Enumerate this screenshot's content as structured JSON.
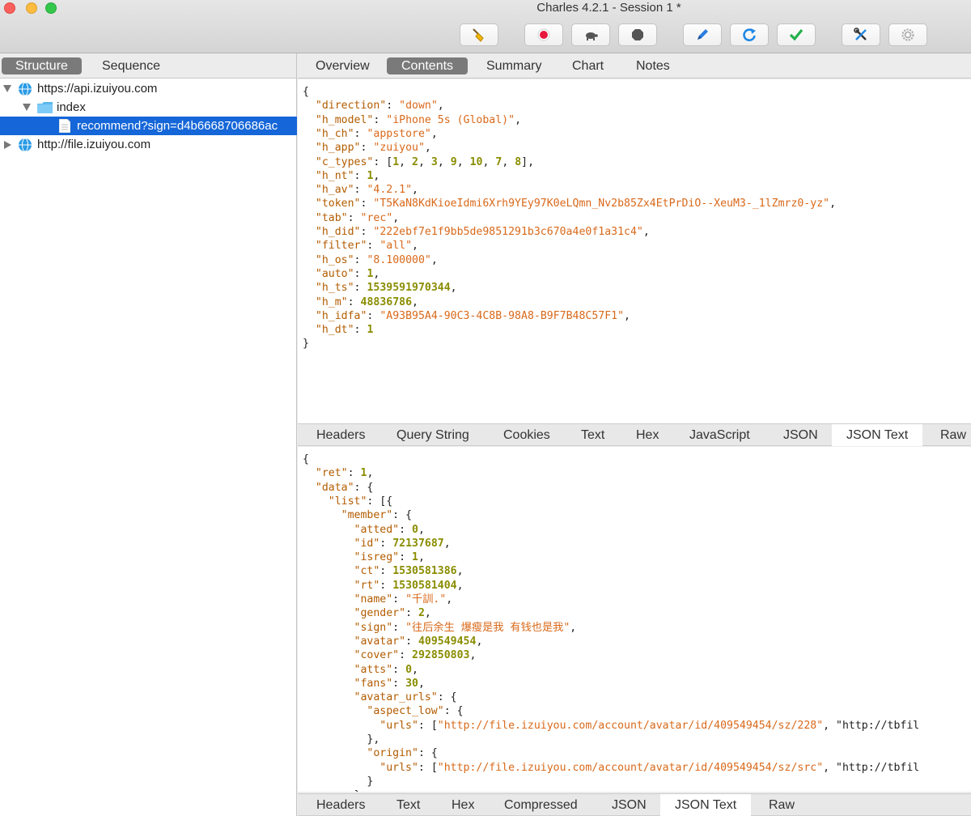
{
  "window": {
    "title": "Charles 4.2.1 - Session 1 *"
  },
  "toolbar": {
    "buttons": [
      {
        "icon": "broom-icon"
      },
      {
        "icon": "record-icon"
      },
      {
        "icon": "turtle-icon"
      },
      {
        "icon": "stop-icon"
      },
      {
        "icon": "pen-icon"
      },
      {
        "icon": "refresh-icon"
      },
      {
        "icon": "check-icon"
      },
      {
        "icon": "tools-icon"
      },
      {
        "icon": "settings-icon"
      }
    ]
  },
  "left": {
    "tabs": [
      {
        "label": "Structure",
        "active": true
      },
      {
        "label": "Sequence",
        "active": false
      }
    ],
    "tree": [
      {
        "label": "https://api.izuiyou.com",
        "icon": "globe-icon",
        "expanded": true,
        "level": 0
      },
      {
        "label": "index",
        "icon": "folder-icon",
        "expanded": true,
        "level": 1
      },
      {
        "label": "recommend?sign=d4b6668706686ac",
        "icon": "document-icon",
        "level": 2,
        "selected": true
      },
      {
        "label": "http://file.izuiyou.com",
        "icon": "globe-icon",
        "expanded": false,
        "level": 0
      }
    ]
  },
  "right": {
    "tabs": [
      {
        "label": "Overview",
        "active": false
      },
      {
        "label": "Contents",
        "active": true
      },
      {
        "label": "Summary",
        "active": false
      },
      {
        "label": "Chart",
        "active": false
      },
      {
        "label": "Notes",
        "active": false
      }
    ],
    "request_lines": [
      "{",
      "  \"direction\": \"down\",",
      "  \"h_model\": \"iPhone 5s (Global)\",",
      "  \"h_ch\": \"appstore\",",
      "  \"h_app\": \"zuiyou\",",
      "  \"c_types\": [1, 2, 3, 9, 10, 7, 8],",
      "  \"h_nt\": 1,",
      "  \"h_av\": \"4.2.1\",",
      "  \"token\": \"T5KaN8KdKioeIdmi6Xrh9YEy97K0eLQmn_Nv2b85Zx4EtPrDiO--XeuM3-_1lZmrz0-yz\",",
      "  \"tab\": \"rec\",",
      "  \"h_did\": \"222ebf7e1f9bb5de9851291b3c670a4e0f1a31c4\",",
      "  \"filter\": \"all\",",
      "  \"h_os\": \"8.100000\",",
      "  \"auto\": 1,",
      "  \"h_ts\": 1539591970344,",
      "  \"h_m\": 48836786,",
      "  \"h_idfa\": \"A93B95A4-90C3-4C8B-98A8-B9F7B48C57F1\",",
      "  \"h_dt\": 1",
      "}"
    ],
    "request_tabs": [
      {
        "label": "Headers",
        "active": false
      },
      {
        "label": "Query String",
        "active": false
      },
      {
        "label": "Cookies",
        "active": false
      },
      {
        "label": "Text",
        "active": false
      },
      {
        "label": "Hex",
        "active": false
      },
      {
        "label": "JavaScript",
        "active": false
      },
      {
        "label": "JSON",
        "active": false
      },
      {
        "label": "JSON Text",
        "active": true
      },
      {
        "label": "Raw",
        "active": false
      }
    ],
    "response_lines": [
      "{",
      "  \"ret\": 1,",
      "  \"data\": {",
      "    \"list\": [{",
      "      \"member\": {",
      "        \"atted\": 0,",
      "        \"id\": 72137687,",
      "        \"isreg\": 1,",
      "        \"ct\": 1530581386,",
      "        \"rt\": 1530581404,",
      "        \"name\": \"千訓.\",",
      "        \"gender\": 2,",
      "        \"sign\": \"往后余生 爆瘦是我 有钱也是我\",",
      "        \"avatar\": 409549454,",
      "        \"cover\": 292850803,",
      "        \"atts\": 0,",
      "        \"fans\": 30,",
      "        \"avatar_urls\": {",
      "          \"aspect_low\": {",
      "            \"urls\": [\"http://file.izuiyou.com/account/avatar/id/409549454/sz/228\", \"http://tbfil",
      "          },",
      "          \"origin\": {",
      "            \"urls\": [\"http://file.izuiyou.com/account/avatar/id/409549454/sz/src\", \"http://tbfil",
      "          }",
      "        }"
    ],
    "response_tabs": [
      {
        "label": "Headers",
        "active": false
      },
      {
        "label": "Text",
        "active": false
      },
      {
        "label": "Hex",
        "active": false
      },
      {
        "label": "Compressed",
        "active": false
      },
      {
        "label": "JSON",
        "active": false
      },
      {
        "label": "JSON Text",
        "active": true
      },
      {
        "label": "Raw",
        "active": false
      }
    ]
  }
}
